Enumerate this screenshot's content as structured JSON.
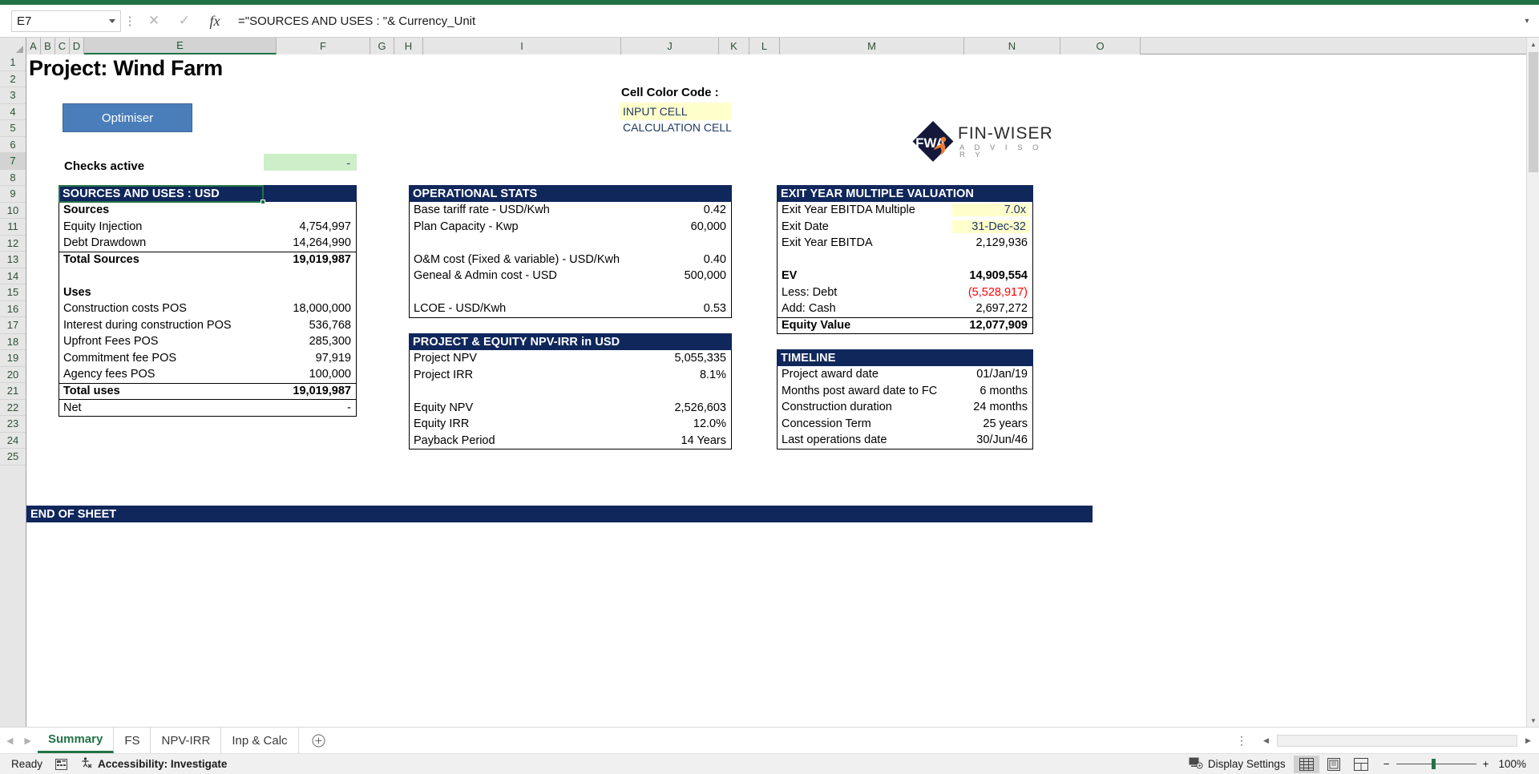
{
  "formula_bar": {
    "name_box": "E7",
    "formula": "=\"SOURCES AND USES : \"& Currency_Unit",
    "cancel_icon": "✕",
    "confirm_icon": "✓",
    "fx_icon": "fx"
  },
  "columns": [
    "A",
    "B",
    "C",
    "D",
    "E",
    "F",
    "G",
    "H",
    "I",
    "J",
    "K",
    "L",
    "M",
    "N",
    "O"
  ],
  "rows": [
    1,
    2,
    3,
    4,
    5,
    6,
    7,
    8,
    9,
    10,
    11,
    12,
    13,
    14,
    15,
    16,
    17,
    18,
    19,
    20,
    21,
    22,
    23,
    24,
    25
  ],
  "header": {
    "title": "Project: Wind Farm",
    "optimiser_button": "Optimiser",
    "checks_label": "Checks active",
    "checks_value": "-",
    "color_code_title": "Cell Color Code :",
    "input_cell_label": "INPUT CELL",
    "calculation_cell_label": "CALCULATION CELL",
    "logo_name": "FIN-WISER",
    "logo_sub": "A D V I S O R Y",
    "logo_mark_text": "FWA"
  },
  "sources_and_uses": {
    "title": "SOURCES AND USES : USD",
    "rows": [
      {
        "label": "Sources",
        "value": "",
        "bold": true
      },
      {
        "label": "Equity Injection",
        "value": "4,754,997",
        "bold": false
      },
      {
        "label": "Debt Drawdown",
        "value": "14,264,990",
        "bold": false
      },
      {
        "label": "Total Sources",
        "value": "19,019,987",
        "bold": true,
        "topline": true
      },
      {
        "label": "",
        "value": "",
        "bold": false
      },
      {
        "label": "Uses",
        "value": "",
        "bold": true
      },
      {
        "label": "Construction costs POS",
        "value": "18,000,000",
        "bold": false
      },
      {
        "label": "Interest during construction POS",
        "value": "536,768",
        "bold": false
      },
      {
        "label": "Upfront Fees  POS",
        "value": "285,300",
        "bold": false
      },
      {
        "label": "Commitment fee POS",
        "value": "97,919",
        "bold": false
      },
      {
        "label": "Agency fees  POS",
        "value": "100,000",
        "bold": false
      },
      {
        "label": "Total uses",
        "value": "19,019,987",
        "bold": true,
        "topline": true
      },
      {
        "label": "Net",
        "value": "-",
        "bold": false,
        "topline": true
      }
    ]
  },
  "operational_stats": {
    "title": "OPERATIONAL STATS",
    "rows": [
      {
        "label": "Base tariff rate - USD/Kwh",
        "value": "0.42"
      },
      {
        "label": "Plan Capacity - Kwp",
        "value": "60,000"
      },
      {
        "label": "",
        "value": ""
      },
      {
        "label": "O&M cost (Fixed & variable) - USD/Kwh",
        "value": "0.40"
      },
      {
        "label": "Geneal & Admin cost - USD",
        "value": "500,000"
      },
      {
        "label": "",
        "value": ""
      },
      {
        "label": "LCOE - USD/Kwh",
        "value": "0.53"
      }
    ]
  },
  "npv_irr": {
    "title": "PROJECT & EQUITY NPV-IRR in USD",
    "rows": [
      {
        "label": "Project NPV",
        "value": "5,055,335"
      },
      {
        "label": "Project IRR",
        "value": "8.1%"
      },
      {
        "label": "",
        "value": ""
      },
      {
        "label": "Equity NPV",
        "value": "2,526,603"
      },
      {
        "label": "Equity IRR",
        "value": "12.0%"
      },
      {
        "label": "Payback Period",
        "value": "14 Years"
      }
    ]
  },
  "exit_year_valuation": {
    "title": "EXIT YEAR MULTIPLE VALUATION",
    "rows": [
      {
        "label": "Exit Year EBITDA Multiple",
        "value": "7.0x",
        "style": "input"
      },
      {
        "label": "Exit Date",
        "value": "31-Dec-32",
        "style": "input"
      },
      {
        "label": "Exit Year EBITDA",
        "value": "2,129,936",
        "style": "normal"
      },
      {
        "label": "",
        "value": "",
        "style": "normal"
      },
      {
        "label": "EV",
        "value": "14,909,554",
        "style": "bold"
      },
      {
        "label": "Less: Debt",
        "value": "(5,528,917)",
        "style": "red"
      },
      {
        "label": "Add: Cash",
        "value": "2,697,272",
        "style": "normal"
      },
      {
        "label": "Equity Value",
        "value": "12,077,909",
        "style": "bold-topline"
      }
    ]
  },
  "timeline": {
    "title": "TIMELINE",
    "rows": [
      {
        "label": "Project award date",
        "value": "01/Jan/19"
      },
      {
        "label": "Months post award date to FC",
        "value": "6 months"
      },
      {
        "label": "Construction duration",
        "value": "24 months"
      },
      {
        "label": "Concession Term",
        "value": "25 years"
      },
      {
        "label": "Last operations date",
        "value": "30/Jun/46"
      }
    ]
  },
  "end_of_sheet": "END OF SHEET",
  "sheet_tabs": {
    "tabs": [
      "Summary",
      "FS",
      "NPV-IRR",
      "Inp & Calc"
    ],
    "active": "Summary",
    "add_label": "+",
    "prev_icon": "◀",
    "next_icon": "▶"
  },
  "status_bar": {
    "state": "Ready",
    "accessibility": "Accessibility: Investigate",
    "display_settings": "Display Settings",
    "zoom": "100%",
    "zoom_out": "−",
    "zoom_in": "+"
  },
  "colors": {
    "panel_header": "#10275c",
    "accent_green": "#217346",
    "input_yellow": "#ffffcc",
    "check_green": "#cdeec9",
    "button_blue": "#4a7ebb",
    "negative_red": "#ff0000"
  }
}
